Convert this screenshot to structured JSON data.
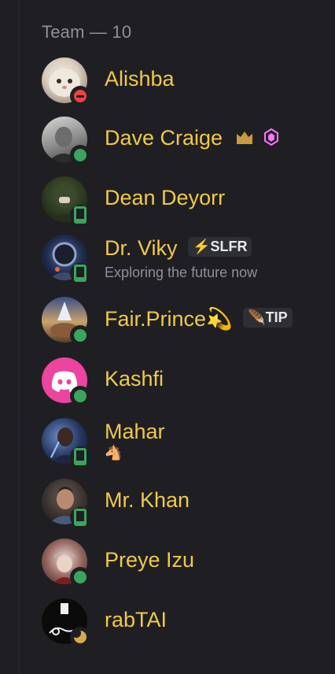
{
  "header": {
    "title": "Team — 10"
  },
  "members": [
    {
      "name": "Alishba",
      "status": "dnd"
    },
    {
      "name": "Dave Craige",
      "status": "online",
      "badges": [
        "crown-icon",
        "boost-gem-icon"
      ]
    },
    {
      "name": "Dean Deyorr",
      "status": "mobile"
    },
    {
      "name": "Dr. Viky",
      "status": "mobile",
      "tag": {
        "emoji": "⚡",
        "text": "SLFR"
      },
      "activity": "Exploring the future now"
    },
    {
      "name": "Fair.Prince💫",
      "status": "online",
      "tag": {
        "emoji": "🪶",
        "text": "TIP"
      }
    },
    {
      "name": "Kashfi",
      "status": "online"
    },
    {
      "name": "Mahar",
      "status": "mobile",
      "activity": "🐴"
    },
    {
      "name": "Mr. Khan",
      "status": "mobile"
    },
    {
      "name": "Preye Izu",
      "status": "online"
    },
    {
      "name": "rabTAI",
      "status": "idle"
    }
  ],
  "colors": {
    "name": "#f0c94a",
    "background": "#1f1f23",
    "online": "#3ba55d",
    "dnd": "#ed4245",
    "idle": "#d9a84e",
    "discord_blurple": "#eb459f"
  }
}
